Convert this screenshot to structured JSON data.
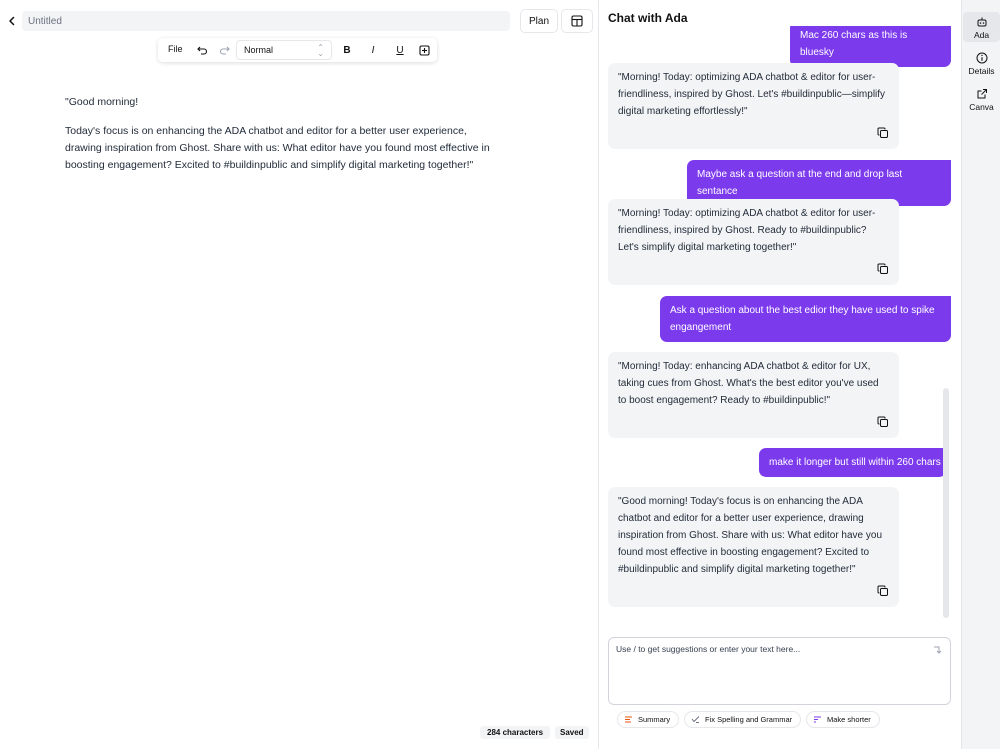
{
  "editor": {
    "title_placeholder": "Untitled",
    "plan_label": "Plan",
    "toolbar": {
      "file_label": "File",
      "style_value": "Normal"
    },
    "paragraphs": [
      "\"Good morning!",
      "Today's focus is on enhancing the ADA chatbot and editor for a better user experience, drawing inspiration from Ghost. Share with us: What editor have you found most effective in boosting engagement? Excited to #buildinpublic and simplify digital marketing together!\""
    ],
    "status": {
      "char_count": "284 characters",
      "save_state": "Saved"
    }
  },
  "chat": {
    "title": "Chat with Ada",
    "messages": [
      {
        "role": "user",
        "text": "Mac 260 chars as this is bluesky"
      },
      {
        "role": "assistant",
        "text": "\"Morning! Today: optimizing ADA chatbot & editor for user-friendliness, inspired by Ghost. Let's #buildinpublic—simplify digital marketing effortlessly!\""
      },
      {
        "role": "user",
        "text": "Maybe ask a question at the end and drop last sentance"
      },
      {
        "role": "assistant",
        "text": "\"Morning! Today: optimizing ADA chatbot & editor for user-friendliness, inspired by Ghost. Ready to #buildinpublic? Let's simplify digital marketing together!\""
      },
      {
        "role": "user",
        "text": "Ask a question about the best edior they have used to spike engangement"
      },
      {
        "role": "assistant",
        "text": "\"Morning! Today: enhancing ADA chatbot & editor for UX, taking cues from Ghost. What's the best editor you've used to boost engagement? Ready to #buildinpublic!\""
      },
      {
        "role": "user",
        "text": "make it longer but still within 260 chars"
      },
      {
        "role": "assistant",
        "text": "\"Good morning! Today's focus is on enhancing the ADA chatbot and editor for a better user experience, drawing inspiration from Ghost. Share with us: What editor have you found most effective in boosting engagement? Excited to #buildinpublic and simplify digital marketing together!\""
      }
    ],
    "input_placeholder": "Use / to get suggestions or enter your text here...",
    "quick_actions": [
      {
        "label": "Summary",
        "icon": "list-icon"
      },
      {
        "label": "Fix Spelling and Grammar",
        "icon": "magic-wand-icon"
      },
      {
        "label": "Make shorter",
        "icon": "shorten-icon"
      }
    ]
  },
  "rail": {
    "items": [
      {
        "label": "Ada",
        "icon": "robot-icon",
        "active": true
      },
      {
        "label": "Details",
        "icon": "info-icon",
        "active": false
      },
      {
        "label": "Canva",
        "icon": "external-link-icon",
        "active": false
      }
    ]
  },
  "colors": {
    "accent": "#7c3aed",
    "bubble_bot": "#f3f4f6",
    "rail_bg": "#f3f4f6"
  }
}
